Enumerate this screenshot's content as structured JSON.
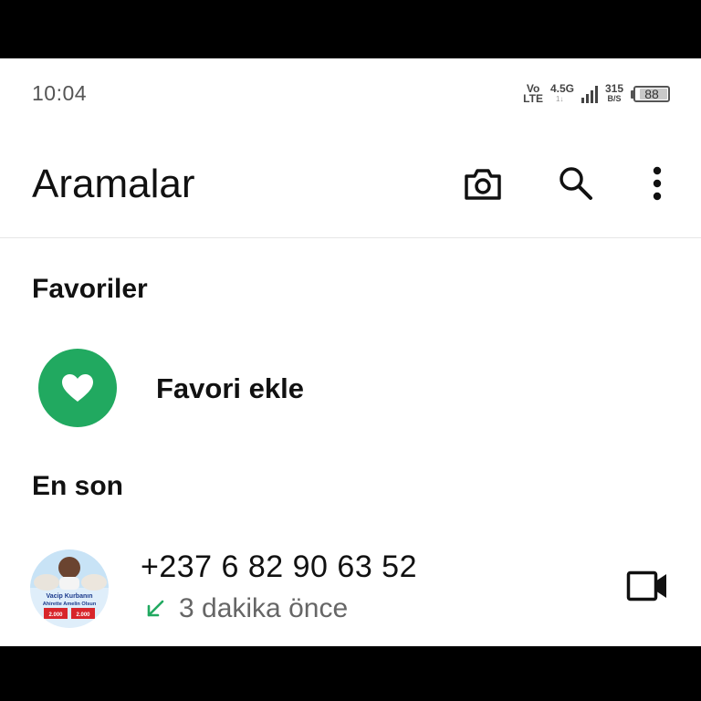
{
  "status_bar": {
    "time": "10:04",
    "volte_top": "Vo",
    "volte_bottom": "LTE",
    "network": "4.5G",
    "network_sub": "1↓",
    "speed_value": "315",
    "speed_unit": "B/S",
    "battery_level": "88",
    "battery_fraction": 0.88
  },
  "app_bar": {
    "title": "Aramalar",
    "icons": [
      "camera-icon",
      "search-icon",
      "more-vert-icon"
    ]
  },
  "favorites": {
    "header": "Favoriler",
    "add_label": "Favori ekle",
    "add_icon": "heart-icon",
    "accent": "#21a960"
  },
  "recent": {
    "header": "En son",
    "calls": [
      {
        "number": "+237 6 82 90 63 52",
        "time": "3 dakika önce",
        "direction_icon": "incoming-call-arrow-icon",
        "direction_color": "#21a960",
        "action_icon": "video-call-icon",
        "avatar_lines": [
          "Vacip Kurbanın",
          "Ahirette Amelin Olsun",
          "2.000",
          "2.000"
        ]
      }
    ]
  }
}
